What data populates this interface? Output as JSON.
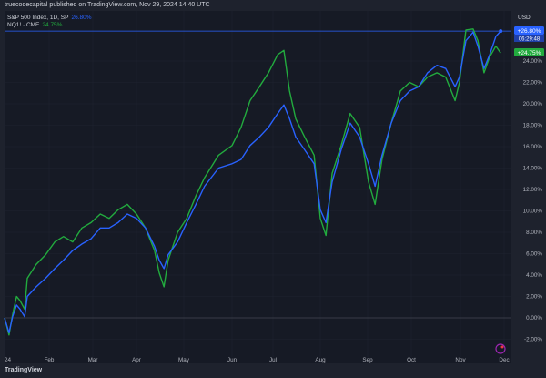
{
  "header": {
    "publisher": "truecodecapital published on TradingView.com, Nov 29, 2024 14:40 UTC"
  },
  "legend": [
    {
      "name": "S&P 500 Index, 1D, SP",
      "value": "26.80%"
    },
    {
      "name": "NQ1! · CME",
      "value": "24.75%"
    }
  ],
  "axis": {
    "currency": "USD"
  },
  "badges": {
    "spx": "+26.80%",
    "spx_timer": "06:29:48",
    "nq": "+24.75%"
  },
  "footer": {
    "brand": "TradingView"
  },
  "colors": {
    "spx": "#2962ff",
    "nq": "#22ab3e",
    "bg": "#161a25",
    "grid": "#1f2330"
  },
  "chart_data": {
    "type": "line",
    "title": "S&P 500 vs NQ1! percent change 2024",
    "x_unit": "months since Jan 1 2024",
    "xticks": [
      "24",
      "Feb",
      "Mar",
      "Apr",
      "May",
      "Jun",
      "Jul",
      "Aug",
      "Sep",
      "Oct",
      "Nov",
      "Dec"
    ],
    "yticks": [
      "-2.00%",
      "0.00%",
      "2.00%",
      "4.00%",
      "6.00%",
      "8.00%",
      "10.00%",
      "12.00%",
      "14.00%",
      "16.00%",
      "18.00%",
      "20.00%",
      "22.00%",
      "24.00%"
    ],
    "ylim": [
      -2.6,
      29.5
    ],
    "x": [
      0,
      0.1,
      0.18,
      0.27,
      0.35,
      0.45,
      0.51,
      0.71,
      0.92,
      1.13,
      1.33,
      1.54,
      1.75,
      1.96,
      2.17,
      2.375,
      2.58,
      2.79,
      3.0,
      3.19,
      3.38,
      3.48,
      3.58,
      3.67,
      3.87,
      4.06,
      4.25,
      4.43,
      4.72,
      5.0,
      5.22,
      5.44,
      5.67,
      5.89,
      6.1,
      6.23,
      6.35,
      6.48,
      6.67,
      6.87,
      7.0,
      7.12,
      7.25,
      7.44,
      7.63,
      7.83,
      8.02,
      8.17,
      8.33,
      8.54,
      8.75,
      8.96,
      9.15,
      9.33,
      9.52,
      9.7,
      9.89,
      9.98,
      10.125,
      10.29,
      10.4,
      10.54,
      10.67,
      10.81,
      10.92
    ],
    "series": [
      {
        "name": "S&P 500 Index",
        "values": [
          0,
          -1.4,
          0.1,
          1.2,
          0.8,
          0.1,
          2.0,
          2.9,
          3.7,
          4.6,
          5.4,
          6.3,
          6.9,
          7.4,
          8.4,
          8.4,
          8.9,
          9.7,
          9.3,
          8.4,
          6.7,
          5.4,
          4.6,
          5.9,
          7.1,
          8.9,
          10.6,
          12.3,
          14.0,
          14.4,
          14.8,
          16.1,
          16.9,
          17.8,
          19.1,
          19.9,
          18.6,
          16.9,
          15.7,
          14.4,
          10.1,
          8.9,
          12.7,
          15.7,
          18.2,
          16.9,
          14.4,
          12.3,
          15.2,
          18.2,
          20.3,
          21.2,
          21.6,
          22.9,
          23.6,
          23.3,
          21.6,
          22.5,
          25.9,
          26.7,
          25.4,
          23.3,
          24.6,
          26.3,
          26.8
        ]
      },
      {
        "name": "NQ1! · CME",
        "values": [
          0,
          -1.6,
          0.3,
          2.0,
          1.6,
          0.8,
          3.7,
          5.0,
          5.9,
          7.1,
          7.6,
          7.1,
          8.4,
          8.9,
          9.7,
          9.3,
          10.1,
          10.6,
          9.7,
          8.4,
          6.3,
          4.2,
          2.9,
          5.4,
          8.0,
          9.3,
          11.4,
          13.1,
          15.2,
          16.1,
          17.8,
          20.3,
          21.6,
          22.9,
          24.6,
          25.0,
          21.2,
          18.6,
          16.9,
          15.2,
          9.3,
          7.7,
          13.5,
          16.1,
          19.1,
          17.8,
          12.7,
          10.6,
          14.8,
          18.2,
          21.2,
          22.0,
          21.6,
          22.5,
          22.9,
          22.5,
          20.3,
          22.0,
          26.9,
          27.0,
          25.9,
          22.9,
          24.4,
          25.4,
          24.75
        ]
      }
    ]
  }
}
